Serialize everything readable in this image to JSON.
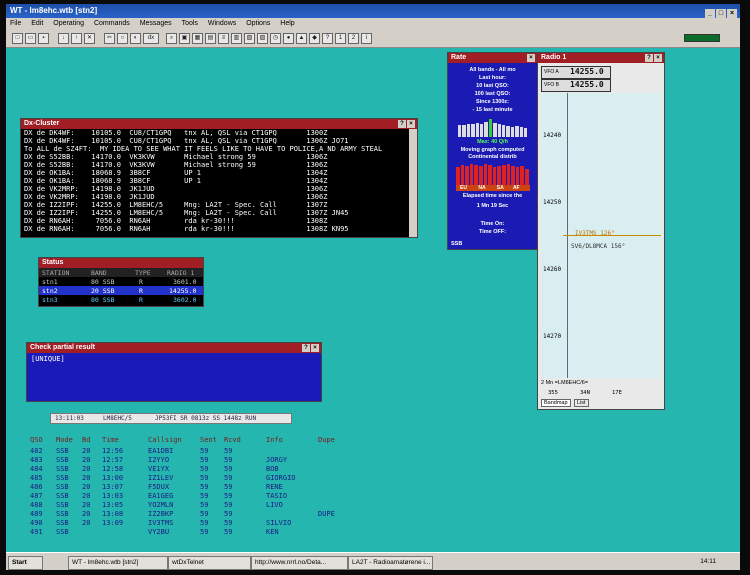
{
  "titlebar": {
    "title": "WT - lm8ehc.wtb [stn2]"
  },
  "menu": [
    "File",
    "Edit",
    "Operating",
    "Commands",
    "Messages",
    "Tools",
    "Windows",
    "Options",
    "Help"
  ],
  "toolbar": {
    "dx_label": "dx"
  },
  "dx_cluster": {
    "title": "Dx-Cluster",
    "lines": [
      "DX de DK4WF:    10105.0  CU8/CT1GPQ   tnx AL, QSL via CT1GPQ       1300Z",
      "DX de DK4WF:    10105.0  CU8/CT1GPQ   tnx AL, QSL via CT1GPQ       1306Z JO71",
      "To ALL de SZ4FT:  MY IDEA TO SEE WHAT IT FEELS LIKE TO HAVE TO POLICE,A ND ARMY STEAL",
      "DX de S52BB:    14170.0  VK3KVW       Michael strong 59            1306Z",
      "DX de S52BB:    14170.0  VK3KVW       Michael strong 59            1306Z",
      "DX de OK1BA:    18068.9  3B8CF        UP 1                         1304Z",
      "DX de OK1BA:    18068.9  3B8CF        UP 1                         1304Z",
      "DX de VK2MRP:   14198.0  JK1JUD                                    1306Z",
      "DX de VK2MRP:   14198.0  JK1JUD                                    1306Z",
      "DX de IZ2IPF:   14255.0  LM8EHC/5     Mng: LA2T - Spec. Call       1307Z",
      "DX de IZ2IPF:   14255.0  LM8EHC/5     Mng: LA2T - Spec. Call       1307Z JN45",
      "DX de RN6AH:     7056.0  RN6AH        rda kr-30!!!                 1308Z",
      "DX de RN6AH:     7056.0  RN6AH        rda kr-30!!!                 1308Z KN95"
    ]
  },
  "status": {
    "title": "Status",
    "headers": [
      "STATION",
      "BAND",
      "TYPE",
      "RADIO 1"
    ],
    "rows": [
      [
        "stn1",
        "80 SSB",
        "R",
        "3601.0"
      ],
      [
        "stn2",
        "20 SSB",
        "R",
        "14255.0"
      ],
      [
        "stn3",
        "80 SSB",
        "R",
        "3602.0"
      ]
    ],
    "selected_row": 1
  },
  "check_partial": {
    "title": "Check partial result",
    "content": "[UNIQUE]"
  },
  "rate": {
    "title": "Rate",
    "lines": [
      "All bands - All mo",
      "Last hour:",
      "10 last QSO:",
      "100 last QSO:",
      "Since 1300z:",
      "- 15 last minute"
    ],
    "max_label": "Max: 40 Q/h",
    "moving_graph": "Moving graph computed",
    "continental": "Continental distrib",
    "continents": [
      "EU",
      "NA",
      "SA",
      "AF"
    ],
    "elapsed_label": "Elapsed time since the",
    "elapsed_value": "1 Mn 19 Sec",
    "time_on": "Time On:",
    "time_off": "Time OFF:",
    "footer": "SSB",
    "bars": [
      0.55,
      0.55,
      0.6,
      0.6,
      0.65,
      0.6,
      0.7,
      0.8,
      0.65,
      0.6,
      0.55,
      0.5,
      0.45,
      0.5,
      0.45,
      0.4
    ],
    "cont_bars": [
      0.8,
      0.9,
      0.85,
      0.95,
      0.9,
      0.85,
      0.95,
      0.9,
      0.8,
      0.85,
      0.9,
      0.95,
      0.85,
      0.8,
      0.85,
      0.75
    ]
  },
  "radio1": {
    "title": "Radio 1",
    "vfo_a_label": "VFO A",
    "vfo_a": "14255.0",
    "vfo_b_label": "VFO B",
    "vfo_b": "14255.0",
    "scale": [
      "14240",
      "14250",
      "14260",
      "14270"
    ],
    "spots": [
      "IV3TMS 126°",
      "SV6/DL8MCA 156°"
    ],
    "footer": "2 Mn =LM8EHC/6=",
    "bottom_nums": [
      "355",
      "34N",
      "17E"
    ],
    "tabs": [
      "Bandmap",
      "List"
    ]
  },
  "infobar": {
    "time": "13:11:03",
    "call": "LM8EHC/5",
    "info": "JP53FI SR 0813z SS 1448z RUN"
  },
  "log": {
    "headers": [
      "QSO",
      "Mode",
      "Bd",
      "Time",
      "Callsign",
      "Sent",
      "Rcvd",
      "Info",
      "Dupe"
    ],
    "rows": [
      [
        "482",
        "SSB",
        "20",
        "12:56",
        "EA1DBI",
        "59",
        "59",
        "",
        ""
      ],
      [
        "483",
        "SSB",
        "20",
        "12:57",
        "I2YYO",
        "59",
        "59",
        "JORGY",
        ""
      ],
      [
        "484",
        "SSB",
        "20",
        "12:58",
        "VE1YX",
        "59",
        "59",
        "BOB",
        ""
      ],
      [
        "485",
        "SSB",
        "20",
        "13:00",
        "IZ1LEV",
        "59",
        "59",
        "GIORGIO",
        ""
      ],
      [
        "486",
        "SSB",
        "20",
        "13:07",
        "F5DUX",
        "59",
        "59",
        "RENE",
        ""
      ],
      [
        "487",
        "SSB",
        "20",
        "13:03",
        "EA1GEG",
        "59",
        "59",
        "TASIO",
        ""
      ],
      [
        "488",
        "SSB",
        "20",
        "13:05",
        "YO2MLN",
        "59",
        "59",
        "LIVO",
        ""
      ],
      [
        "489",
        "SSB",
        "20",
        "13:08",
        "IZ2BKP",
        "59",
        "59",
        "",
        "DUPE"
      ],
      [
        "490",
        "SSB",
        "20",
        "13:09",
        "IV3TMS",
        "59",
        "59",
        "SILVIO",
        ""
      ],
      [
        "491",
        "SSB",
        "",
        "",
        "VY2BU",
        "59",
        "59",
        "KEN",
        ""
      ]
    ]
  },
  "taskbar": {
    "start": "Start",
    "items": [
      "WT - lm8ehc.wtb [stn2]",
      "wtDxTelnet",
      "http://www.nrrl.no/Deta...",
      "LA2T - Radioamatørene i..."
    ],
    "clock": "14:11"
  },
  "colors": {
    "desktop": "#26b6b0",
    "window_title": "#a11e25",
    "titlebar": "#1c4fa8"
  }
}
